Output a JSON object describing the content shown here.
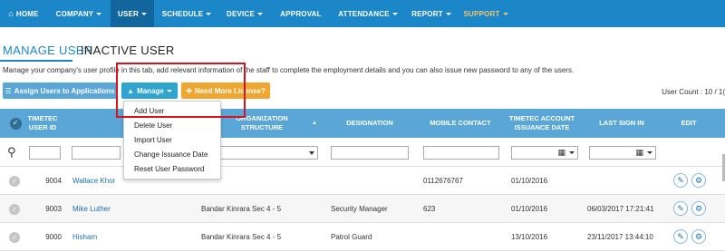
{
  "nav": {
    "items": [
      {
        "label": "HOME",
        "icon": "home-icon",
        "caret": false
      },
      {
        "label": "COMPANY",
        "caret": true
      },
      {
        "label": "USER",
        "caret": true,
        "active": true
      },
      {
        "label": "SCHEDULE",
        "caret": true
      },
      {
        "label": "DEVICE",
        "caret": true
      },
      {
        "label": "APPROVAL",
        "caret": false
      },
      {
        "label": "ATTENDANCE",
        "caret": true
      },
      {
        "label": "REPORT",
        "caret": true
      },
      {
        "label": "SUPPORT",
        "caret": true
      }
    ],
    "colors": {
      "bar": "#1b87c9",
      "active": "#10669d",
      "support": "#f6c36a"
    }
  },
  "tabs": {
    "manage": "MANAGE USER",
    "inactive": "INACTIVE USER"
  },
  "description": "Manage your company's user profile in this tab, add relevant information of the staff to complete the employment details and you can also issue new password to any of the users.",
  "toolbar": {
    "assign": "Assign Users to Applications",
    "manage": "Manage",
    "license": "Need More License?",
    "user_count": "User Count : 10 / 1("
  },
  "table": {
    "headers": {
      "user_id": "TIMETEC USER ID",
      "org": "ORGANIZATION STRUCTURE",
      "designation": "DESIGNATION",
      "mobile": "MOBILE CONTACT",
      "issuance": "TIMETEC ACCOUNT ISSUANCE DATE",
      "last_sign": "LAST SIGN IN",
      "edit": "EDIT"
    },
    "rows": [
      {
        "id": "9004",
        "name": "Wallace Khor",
        "org": "",
        "designation": "",
        "mobile": "0112676767",
        "issuance": "01/10/2016",
        "last_sign": ""
      },
      {
        "id": "9003",
        "name": "Mike Luther",
        "org": "Bandar Kinrara Sec 4 - 5",
        "designation": "Security Manager",
        "mobile": "623",
        "issuance": "01/10/2016",
        "last_sign": "06/03/2017 17:21:41"
      },
      {
        "id": "9000",
        "name": "Hisham",
        "org": "Bandar Kinrara Sec 4 - 5",
        "designation": "Patrol Guard",
        "mobile": "",
        "issuance": "13/10/2016",
        "last_sign": "23/11/2017 13:44:10"
      }
    ]
  },
  "dropdown": {
    "items": [
      "Add User",
      "Delete User",
      "Import User",
      "Change Issuance Date",
      "Reset User Password"
    ]
  }
}
